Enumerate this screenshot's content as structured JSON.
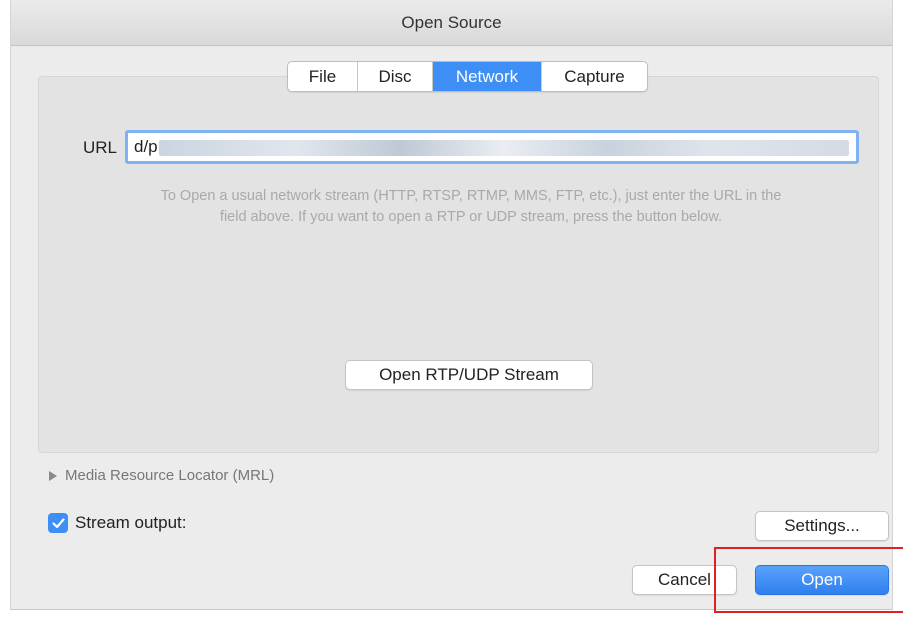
{
  "window": {
    "title": "Open Source"
  },
  "tabs": [
    {
      "label": "File",
      "active": false
    },
    {
      "label": "Disc",
      "active": false
    },
    {
      "label": "Network",
      "active": true
    },
    {
      "label": "Capture",
      "active": false
    }
  ],
  "network": {
    "url_label": "URL",
    "url_value": "d/p",
    "help_line1": "To Open a usual network stream (HTTP, RTSP, RTMP, MMS, FTP, etc.), just enter the URL in the",
    "help_line2": "field above. If you want to open a RTP or UDP stream, press the button below.",
    "rtp_button_label": "Open RTP/UDP Stream"
  },
  "mrl": {
    "label": "Media Resource Locator (MRL)"
  },
  "stream_output": {
    "label": "Stream output:",
    "checked": true,
    "settings_label": "Settings..."
  },
  "footer": {
    "cancel_label": "Cancel",
    "open_label": "Open"
  },
  "colors": {
    "accent": "#3d8ef5",
    "highlight": "#e02020"
  }
}
